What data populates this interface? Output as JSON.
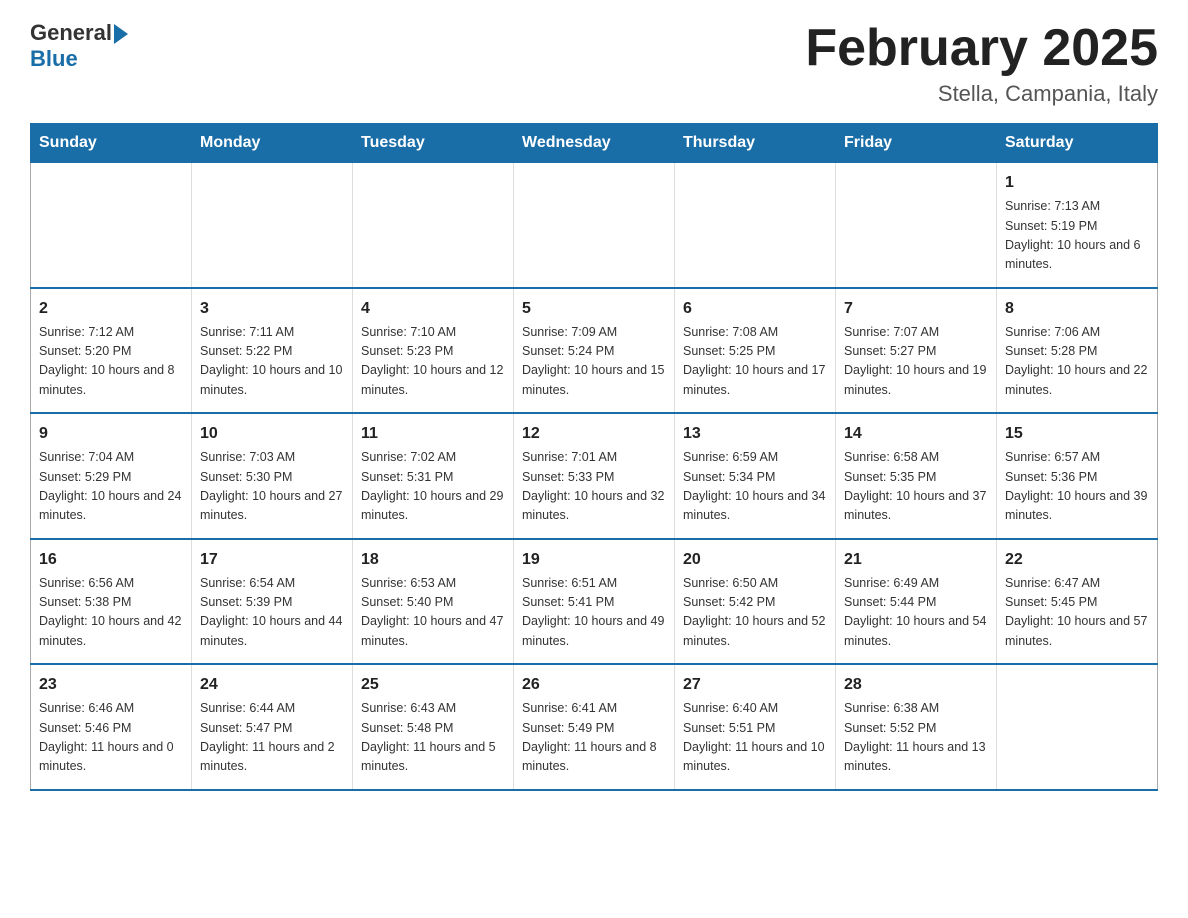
{
  "header": {
    "logo_general": "General",
    "logo_blue": "Blue",
    "month_title": "February 2025",
    "location": "Stella, Campania, Italy"
  },
  "weekdays": [
    "Sunday",
    "Monday",
    "Tuesday",
    "Wednesday",
    "Thursday",
    "Friday",
    "Saturday"
  ],
  "weeks": [
    {
      "days": [
        {
          "date": "",
          "info": ""
        },
        {
          "date": "",
          "info": ""
        },
        {
          "date": "",
          "info": ""
        },
        {
          "date": "",
          "info": ""
        },
        {
          "date": "",
          "info": ""
        },
        {
          "date": "",
          "info": ""
        },
        {
          "date": "1",
          "info": "Sunrise: 7:13 AM\nSunset: 5:19 PM\nDaylight: 10 hours and 6 minutes."
        }
      ]
    },
    {
      "days": [
        {
          "date": "2",
          "info": "Sunrise: 7:12 AM\nSunset: 5:20 PM\nDaylight: 10 hours and 8 minutes."
        },
        {
          "date": "3",
          "info": "Sunrise: 7:11 AM\nSunset: 5:22 PM\nDaylight: 10 hours and 10 minutes."
        },
        {
          "date": "4",
          "info": "Sunrise: 7:10 AM\nSunset: 5:23 PM\nDaylight: 10 hours and 12 minutes."
        },
        {
          "date": "5",
          "info": "Sunrise: 7:09 AM\nSunset: 5:24 PM\nDaylight: 10 hours and 15 minutes."
        },
        {
          "date": "6",
          "info": "Sunrise: 7:08 AM\nSunset: 5:25 PM\nDaylight: 10 hours and 17 minutes."
        },
        {
          "date": "7",
          "info": "Sunrise: 7:07 AM\nSunset: 5:27 PM\nDaylight: 10 hours and 19 minutes."
        },
        {
          "date": "8",
          "info": "Sunrise: 7:06 AM\nSunset: 5:28 PM\nDaylight: 10 hours and 22 minutes."
        }
      ]
    },
    {
      "days": [
        {
          "date": "9",
          "info": "Sunrise: 7:04 AM\nSunset: 5:29 PM\nDaylight: 10 hours and 24 minutes."
        },
        {
          "date": "10",
          "info": "Sunrise: 7:03 AM\nSunset: 5:30 PM\nDaylight: 10 hours and 27 minutes."
        },
        {
          "date": "11",
          "info": "Sunrise: 7:02 AM\nSunset: 5:31 PM\nDaylight: 10 hours and 29 minutes."
        },
        {
          "date": "12",
          "info": "Sunrise: 7:01 AM\nSunset: 5:33 PM\nDaylight: 10 hours and 32 minutes."
        },
        {
          "date": "13",
          "info": "Sunrise: 6:59 AM\nSunset: 5:34 PM\nDaylight: 10 hours and 34 minutes."
        },
        {
          "date": "14",
          "info": "Sunrise: 6:58 AM\nSunset: 5:35 PM\nDaylight: 10 hours and 37 minutes."
        },
        {
          "date": "15",
          "info": "Sunrise: 6:57 AM\nSunset: 5:36 PM\nDaylight: 10 hours and 39 minutes."
        }
      ]
    },
    {
      "days": [
        {
          "date": "16",
          "info": "Sunrise: 6:56 AM\nSunset: 5:38 PM\nDaylight: 10 hours and 42 minutes."
        },
        {
          "date": "17",
          "info": "Sunrise: 6:54 AM\nSunset: 5:39 PM\nDaylight: 10 hours and 44 minutes."
        },
        {
          "date": "18",
          "info": "Sunrise: 6:53 AM\nSunset: 5:40 PM\nDaylight: 10 hours and 47 minutes."
        },
        {
          "date": "19",
          "info": "Sunrise: 6:51 AM\nSunset: 5:41 PM\nDaylight: 10 hours and 49 minutes."
        },
        {
          "date": "20",
          "info": "Sunrise: 6:50 AM\nSunset: 5:42 PM\nDaylight: 10 hours and 52 minutes."
        },
        {
          "date": "21",
          "info": "Sunrise: 6:49 AM\nSunset: 5:44 PM\nDaylight: 10 hours and 54 minutes."
        },
        {
          "date": "22",
          "info": "Sunrise: 6:47 AM\nSunset: 5:45 PM\nDaylight: 10 hours and 57 minutes."
        }
      ]
    },
    {
      "days": [
        {
          "date": "23",
          "info": "Sunrise: 6:46 AM\nSunset: 5:46 PM\nDaylight: 11 hours and 0 minutes."
        },
        {
          "date": "24",
          "info": "Sunrise: 6:44 AM\nSunset: 5:47 PM\nDaylight: 11 hours and 2 minutes."
        },
        {
          "date": "25",
          "info": "Sunrise: 6:43 AM\nSunset: 5:48 PM\nDaylight: 11 hours and 5 minutes."
        },
        {
          "date": "26",
          "info": "Sunrise: 6:41 AM\nSunset: 5:49 PM\nDaylight: 11 hours and 8 minutes."
        },
        {
          "date": "27",
          "info": "Sunrise: 6:40 AM\nSunset: 5:51 PM\nDaylight: 11 hours and 10 minutes."
        },
        {
          "date": "28",
          "info": "Sunrise: 6:38 AM\nSunset: 5:52 PM\nDaylight: 11 hours and 13 minutes."
        },
        {
          "date": "",
          "info": ""
        }
      ]
    }
  ]
}
